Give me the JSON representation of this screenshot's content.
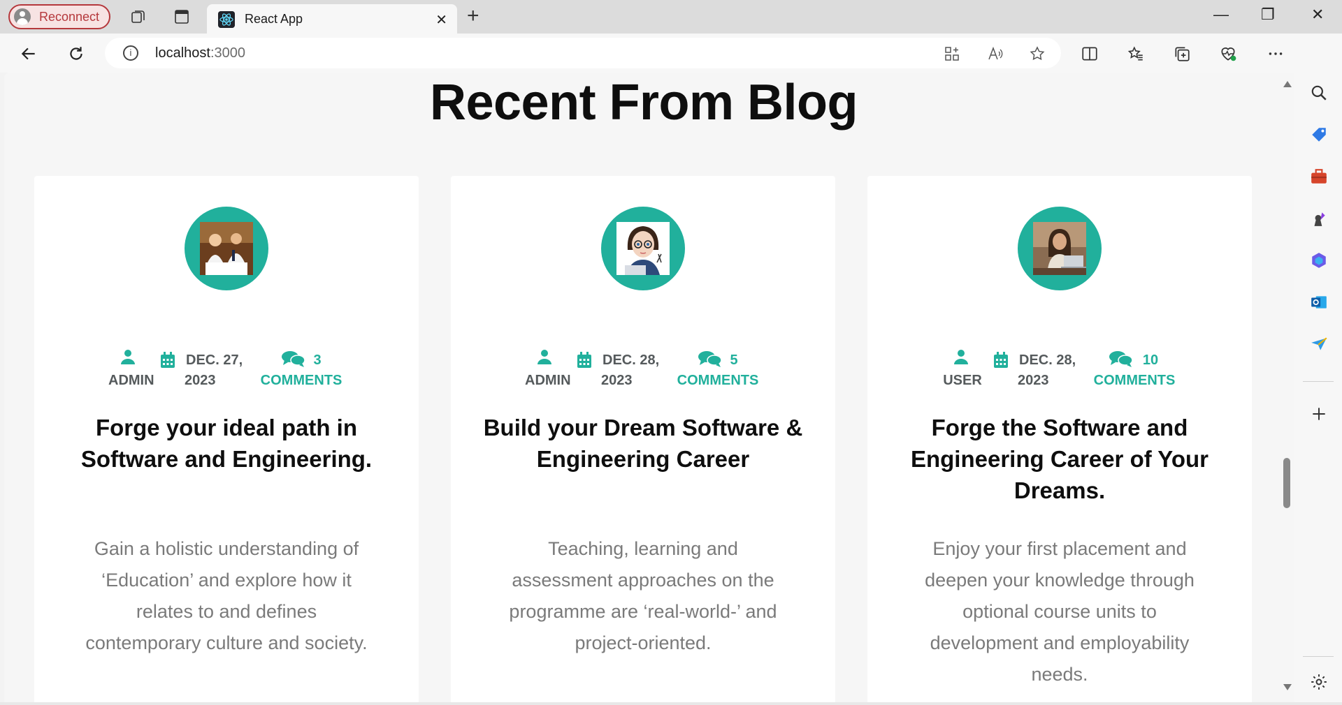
{
  "browser": {
    "reconnect_label": "Reconnect",
    "tab_title": "React App",
    "url_host": "localhost",
    "url_port": ":3000",
    "new_tab_symbol": "+",
    "tab_close_symbol": "✕",
    "window_controls": {
      "minimize": "—",
      "restore": "❐",
      "close": "✕"
    },
    "icons": [
      "workspaces-icon",
      "tab-actions-icon",
      "back-icon",
      "refresh-icon",
      "site-info-icon",
      "app-available-icon",
      "read-aloud-icon",
      "favorite-icon",
      "split-screen-icon",
      "favorites-icon",
      "collections-icon",
      "browser-essentials-icon",
      "more-icon",
      "copilot-icon"
    ]
  },
  "sidebar": {
    "icons": [
      "search-icon",
      "shopping-icon",
      "tools-icon",
      "games-icon",
      "microsoft-365-icon",
      "outlook-icon",
      "send-icon",
      "add-icon",
      "settings-icon"
    ]
  },
  "page": {
    "title": "Recent From Blog",
    "accent_color": "#21b09c",
    "cards": [
      {
        "author": "ADMIN",
        "date_line1": "DEC. 27,",
        "date_line2": "2023",
        "comments_count": "3",
        "comments_label": "COMMENTS",
        "title": "Forge your ideal path in Software and Engineering.",
        "excerpt": "Gain a holistic understanding of ‘Education’ and explore how it relates to and defines contemporary culture and society."
      },
      {
        "author": "ADMIN",
        "date_line1": "DEC. 28,",
        "date_line2": "2023",
        "comments_count": "5",
        "comments_label": "COMMENTS",
        "title": "Build your Dream Software & Engineering Career",
        "excerpt": "Teaching, learning and assessment approaches on the programme are ‘real-world-’ and project-oriented."
      },
      {
        "author": "USER",
        "date_line1": "DEC. 28,",
        "date_line2": "2023",
        "comments_count": "10",
        "comments_label": "COMMENTS",
        "title": "Forge the Software and Engineering Career of Your Dreams.",
        "excerpt": "Enjoy your first placement and deepen your knowledge through optional course units to development and employability needs."
      }
    ]
  }
}
